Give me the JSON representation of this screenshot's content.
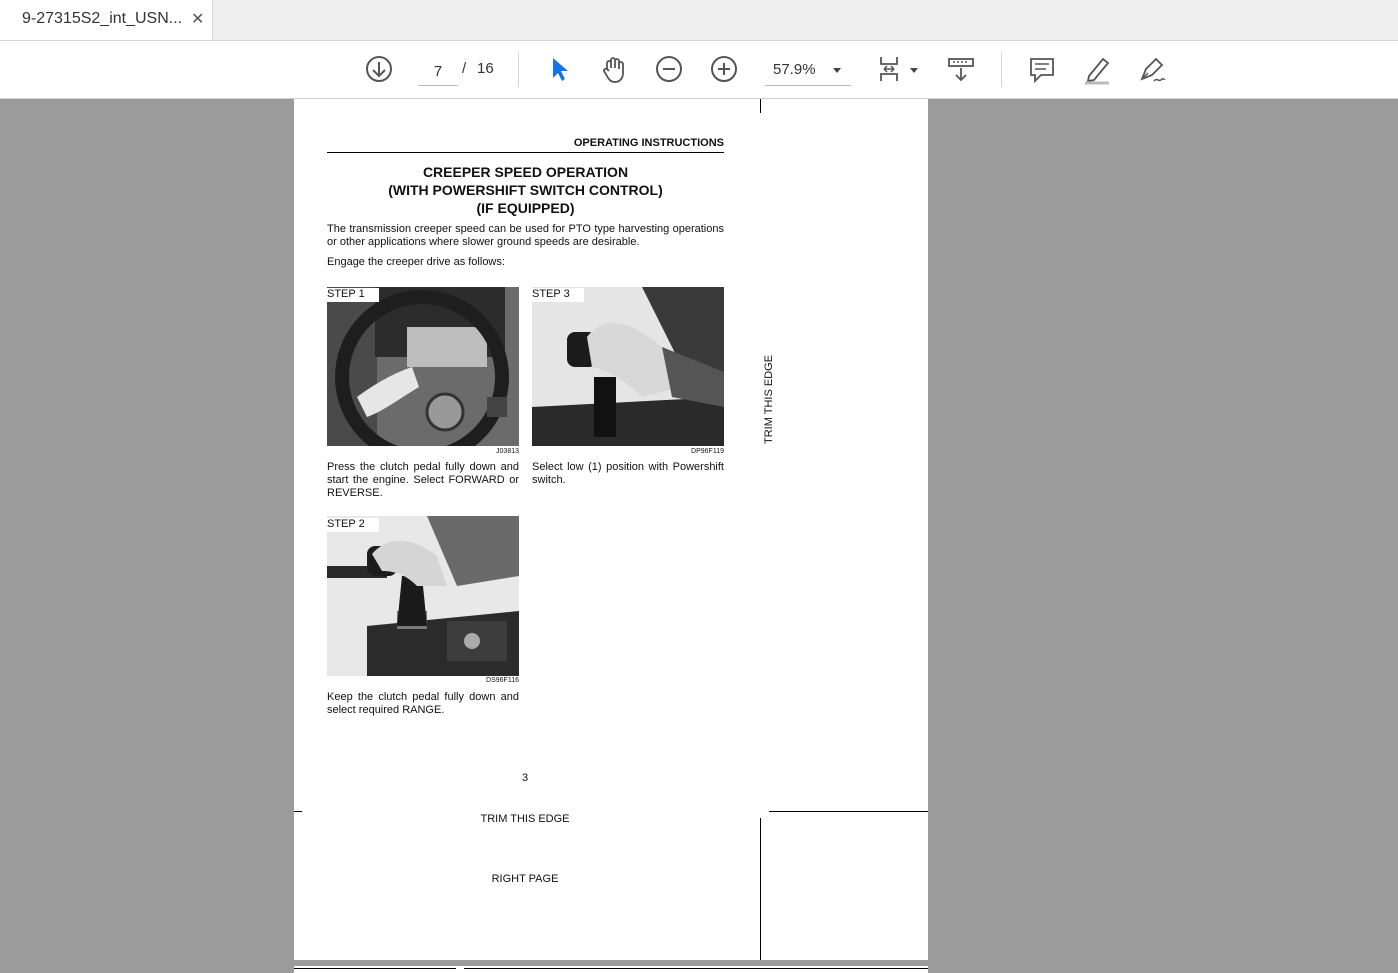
{
  "tab": {
    "title": "9-27315S2_int_USN...",
    "close": "✕"
  },
  "toolbar": {
    "page_current": "7",
    "page_sep": "/",
    "page_total": "16",
    "zoom": "57.9%",
    "icons": [
      "download-arrow-icon",
      "select-cursor-icon",
      "hand-pan-icon",
      "zoom-out-icon",
      "zoom-in-icon",
      "fit-page-icon",
      "scroll-mode-icon",
      "comment-icon",
      "highlight-pen-icon",
      "sign-pen-icon"
    ]
  },
  "document": {
    "header": "OPERATING INSTRUCTIONS",
    "title_lines": [
      "CREEPER SPEED OPERATION",
      "(WITH POWERSHIFT SWITCH CONTROL)",
      "(IF EQUIPPED)"
    ],
    "intro": "The transmission creeper speed can be used for PTO type harvesting operations or other applications where slower ground speeds are desirable.",
    "engage": "Engage the creeper drive as follows:",
    "step1": {
      "label": "STEP  1",
      "code": "J03813",
      "text": "Press the clutch pedal fully down and start the engine. Select FORWARD or REVERSE."
    },
    "step2": {
      "label": "STEP  2",
      "code": "DS96F116",
      "text": "Keep the clutch pedal fully down and select required RANGE."
    },
    "step3": {
      "label": "STEP  3",
      "code": "DP96F119",
      "text": "Select low (1) position with Powershift switch."
    },
    "page_number": "3",
    "trim_vertical": "TRIM THIS EDGE",
    "trim_bottom": "TRIM THIS EDGE",
    "right_page": "RIGHT PAGE"
  }
}
